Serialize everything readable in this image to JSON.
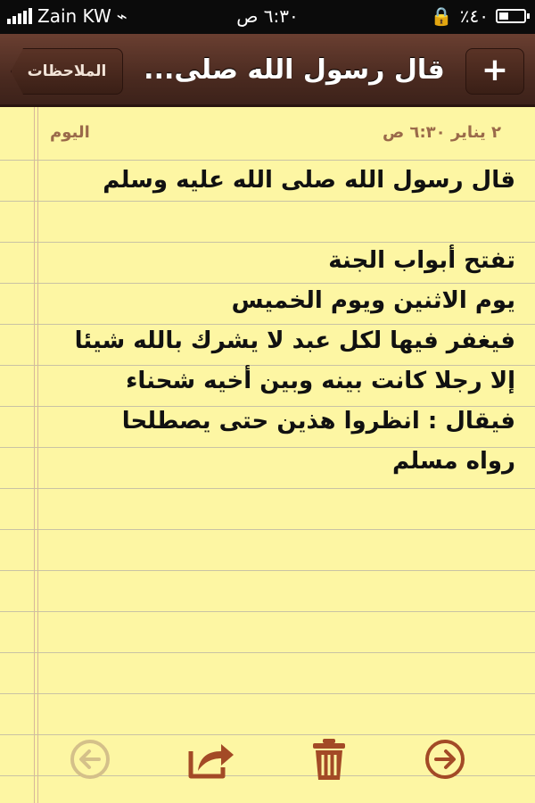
{
  "status_bar": {
    "carrier": "Zain KW",
    "time": "٦:٣٠ ص",
    "battery": "٪٤٠",
    "battery_level": 0.4
  },
  "nav": {
    "back_label": "الملاحظات",
    "title": "قال رسول الله صلى...",
    "add_label": "+"
  },
  "note": {
    "date_label": "اليوم",
    "date": "٢ يناير   ٦:٣٠ ص",
    "lines": [
      "قال رسول الله صلى الله عليه وسلم",
      "",
      "تفتح أبواب الجنة",
      "يوم الاثنين ويوم الخميس",
      "فيغفر فيها لكل عبد لا يشرك بالله شيئا",
      "إلا رجلا كانت بينه وبين أخيه شحناء",
      "فيقال : انظروا هذين حتى يصطلحا",
      "رواه مسلم"
    ]
  },
  "colors": {
    "paper": "#fdf6a3",
    "header": "#4a2a20",
    "toolbar_icon": "#a34a26",
    "toolbar_icon_disabled": "#d4c08a"
  },
  "toolbar": {
    "icons": [
      "back-arrow-icon",
      "share-icon",
      "trash-icon",
      "forward-arrow-icon"
    ]
  }
}
